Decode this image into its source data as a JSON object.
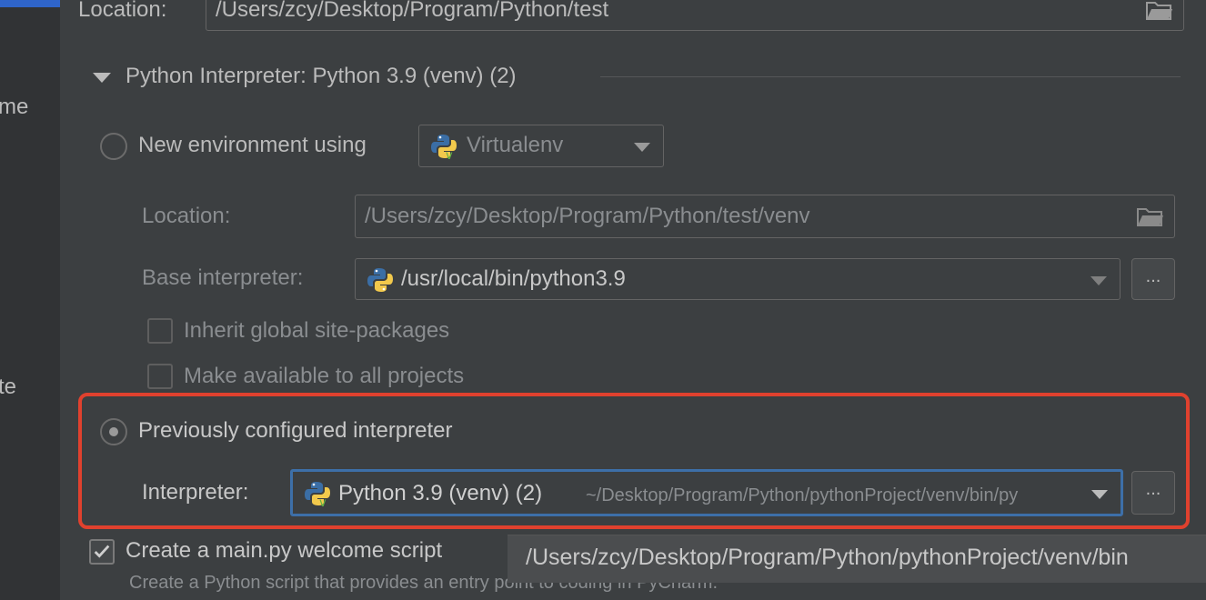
{
  "sidebar": {
    "item_1": "me",
    "item_2": "te"
  },
  "project_location": {
    "label": "Location:",
    "value": "/Users/zcy/Desktop/Program/Python/test"
  },
  "interpreter_section": {
    "title": "Python Interpreter: Python 3.9 (venv) (2)"
  },
  "new_env": {
    "radio_label": "New environment using",
    "tool_value": "Virtualenv",
    "location_label": "Location:",
    "location_value": "/Users/zcy/Desktop/Program/Python/test/venv",
    "base_label": "Base interpreter:",
    "base_value": "/usr/local/bin/python3.9",
    "inherit_label": "Inherit global site-packages",
    "available_label": "Make available to all projects",
    "browse_label": "..."
  },
  "previous": {
    "radio_label": "Previously configured interpreter",
    "interpreter_label": "Interpreter:",
    "interpreter_name": "Python 3.9 (venv) (2)",
    "interpreter_path": "~/Desktop/Program/Python/pythonProject/venv/bin/py",
    "browse_label": "..."
  },
  "welcome": {
    "checkbox_label": "Create a main.py welcome script",
    "checked": true,
    "description": "Create a Python script that provides an entry point to coding in PyCharm."
  },
  "tooltip": {
    "text": "/Users/zcy/Desktop/Program/Python/pythonProject/venv/bin"
  },
  "colors": {
    "background": "#3c3f41",
    "accent_blue": "#2f65ca",
    "highlight_red": "#e0412e",
    "focus_blue": "#3d6fa8"
  }
}
